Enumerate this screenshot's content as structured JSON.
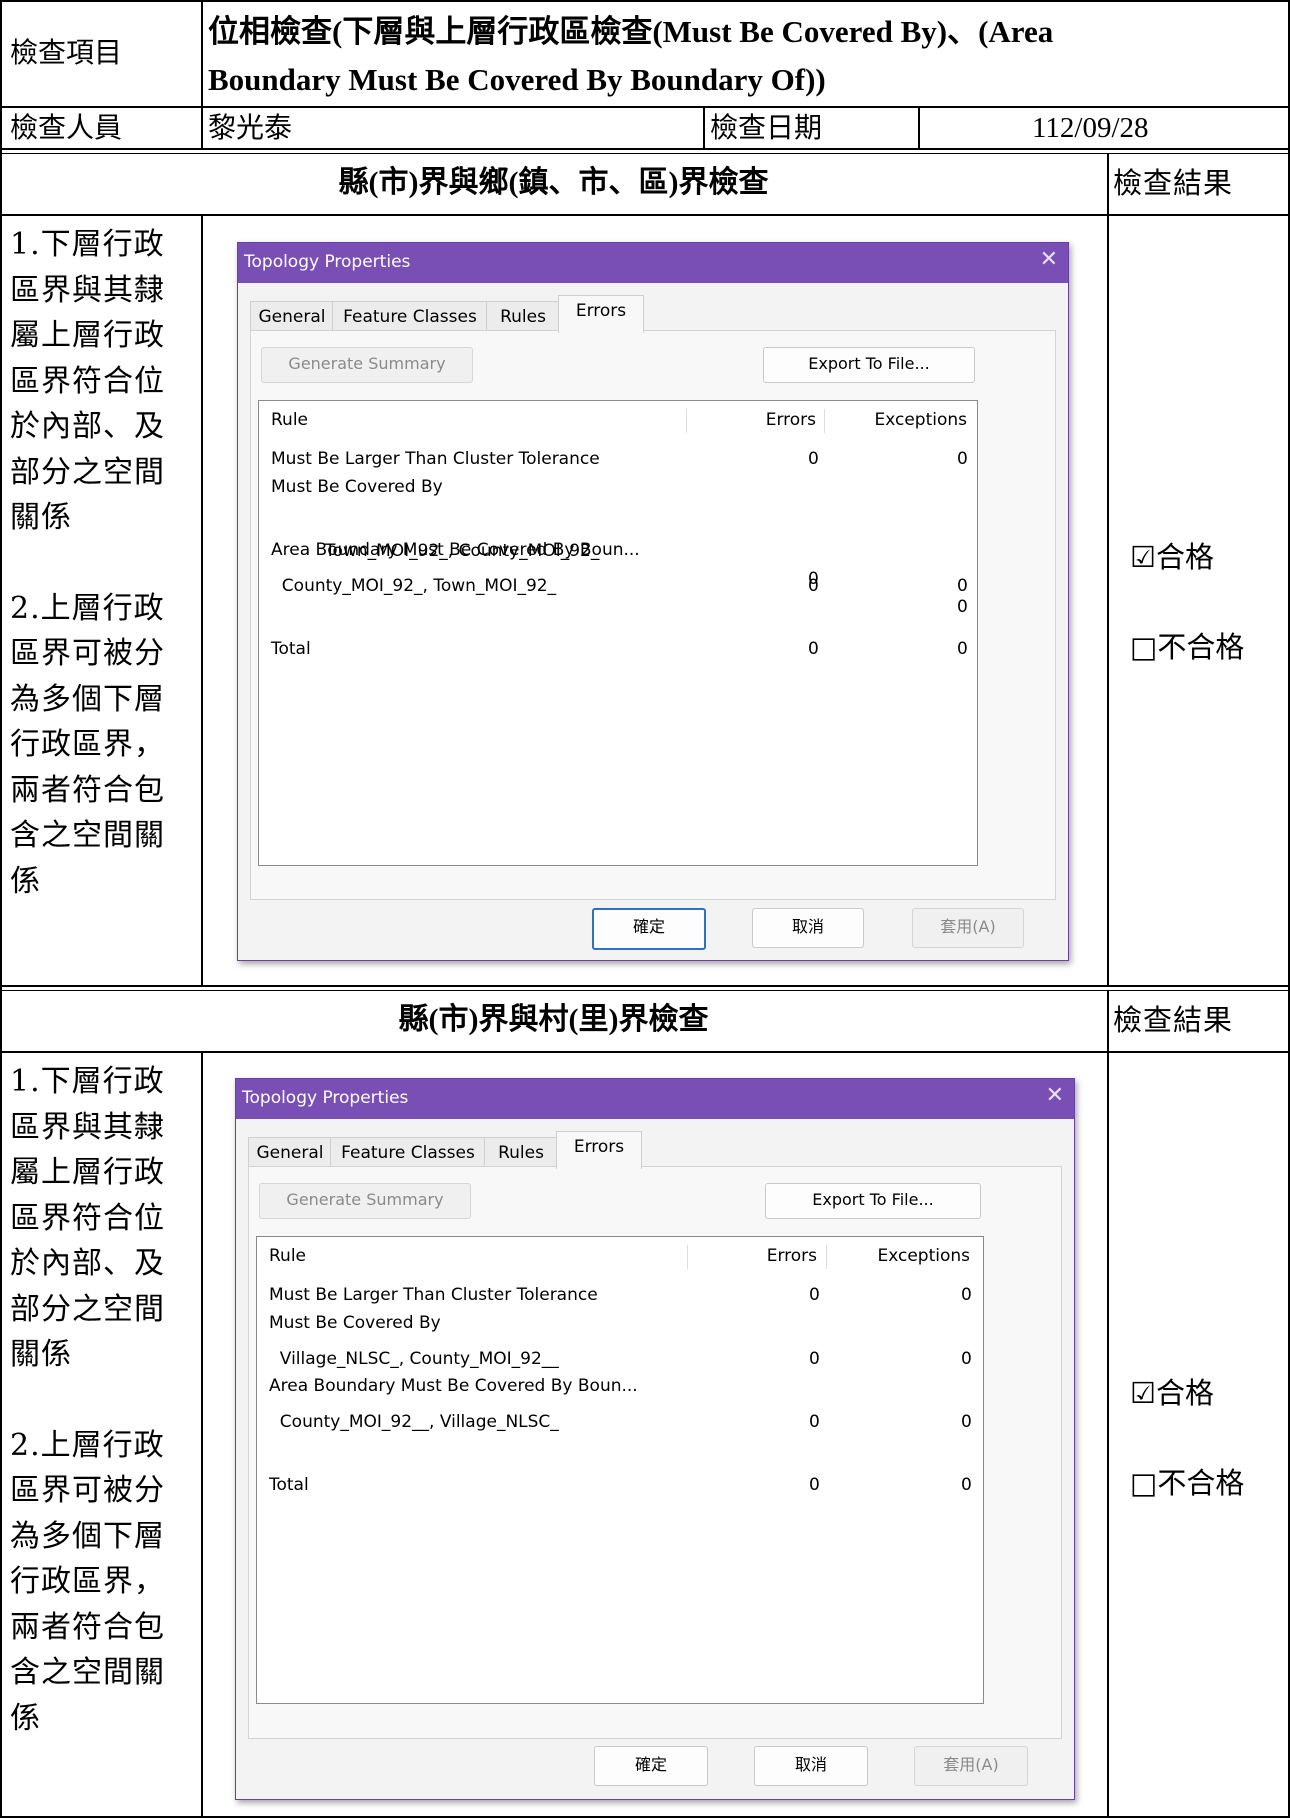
{
  "header": {
    "item_label": "檢查項目",
    "item_value_line1": "位相檢查(下層與上層行政區檢查(Must Be Covered By)、(Area",
    "item_value_line2": "Boundary Must Be Covered By Boundary Of))",
    "inspector_label": "檢查人員",
    "inspector_value": "黎光泰",
    "date_label": "檢查日期",
    "date_value": "112/09/28"
  },
  "sections": [
    {
      "title": "縣(市)界與鄉(鎮、市、區)界檢查",
      "result_header": "檢查結果",
      "desc_1": [
        "1.下層行政",
        "區界與其隸",
        "屬上層行政",
        "區界符合位",
        "於內部、及",
        "部分之空間",
        "關係"
      ],
      "desc_2": [
        "2.上層行政",
        "區界可被分",
        "為多個下層",
        "行政區界，",
        "兩者符合包",
        "含之空間關",
        "係"
      ],
      "result_pass": "☑合格",
      "result_fail": "□不合格",
      "dialog": {
        "title": "Topology Properties",
        "close_glyph": "✕",
        "tabs": [
          "General",
          "Feature Classes",
          "Rules",
          "Errors"
        ],
        "generate_summary": "Generate Summary",
        "export": "Export To File...",
        "col_rule": "Rule",
        "col_errors": "Errors",
        "col_exceptions": "Exceptions",
        "rows": [
          {
            "rule": "Must Be Larger Than Cluster Tolerance",
            "errors": "0",
            "exceptions": "0"
          },
          {
            "rule": "Must Be Covered By",
            "errors": "",
            "exceptions": ""
          },
          {
            "rule": "  Town_MOI_92_, County_MOI_92_",
            "errors": "0",
            "exceptions": "0"
          },
          {
            "rule": "Area Boundary Must Be Covered By Boun...",
            "errors": "",
            "exceptions": ""
          },
          {
            "rule": "  County_MOI_92_, Town_MOI_92_",
            "errors": "0",
            "exceptions": "0"
          },
          {
            "rule": "",
            "errors": "",
            "exceptions": ""
          },
          {
            "rule": "Total",
            "errors": "0",
            "exceptions": "0"
          }
        ],
        "ok": "確定",
        "cancel": "取消",
        "apply": "套用(A)"
      }
    },
    {
      "title": "縣(市)界與村(里)界檢查",
      "result_header": "檢查結果",
      "desc_1": [
        "1.下層行政",
        "區界與其隸",
        "屬上層行政",
        "區界符合位",
        "於內部、及",
        "部分之空間",
        "關係"
      ],
      "desc_2": [
        "2.上層行政",
        "區界可被分",
        "為多個下層",
        "行政區界，",
        "兩者符合包",
        "含之空間關",
        "係"
      ],
      "result_pass": "☑合格",
      "result_fail": "□不合格",
      "dialog": {
        "title": "Topology Properties",
        "close_glyph": "✕",
        "tabs": [
          "General",
          "Feature Classes",
          "Rules",
          "Errors"
        ],
        "generate_summary": "Generate Summary",
        "export": "Export To File...",
        "col_rule": "Rule",
        "col_errors": "Errors",
        "col_exceptions": "Exceptions",
        "rows": [
          {
            "rule": "Must Be Larger Than Cluster Tolerance",
            "errors": "0",
            "exceptions": "0"
          },
          {
            "rule": "Must Be Covered By",
            "errors": "",
            "exceptions": ""
          },
          {
            "rule": "  Village_NLSC_, County_MOI_92__",
            "errors": "0",
            "exceptions": "0"
          },
          {
            "rule": "Area Boundary Must Be Covered By Boun...",
            "errors": "",
            "exceptions": ""
          },
          {
            "rule": "  County_MOI_92__, Village_NLSC_",
            "errors": "0",
            "exceptions": "0"
          },
          {
            "rule": "",
            "errors": "",
            "exceptions": ""
          },
          {
            "rule": "Total",
            "errors": "0",
            "exceptions": "0"
          }
        ],
        "ok": "確定",
        "cancel": "取消",
        "apply": "套用(A)"
      }
    }
  ]
}
